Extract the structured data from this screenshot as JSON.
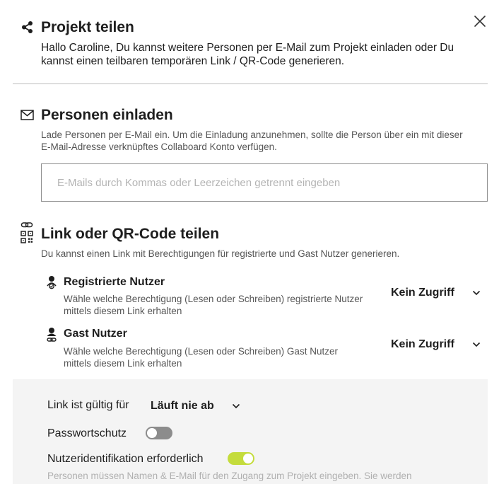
{
  "header": {
    "title": "Projekt teilen",
    "description": "Hallo Caroline, Du kannst weitere Personen per E-Mail zum Projekt einladen oder Du kannst einen teilbaren temporären Link / QR-Code generieren."
  },
  "invite": {
    "title": "Personen einladen",
    "description": "Lade Personen per E-Mail ein. Um die Einladung anzunehmen, sollte die Person über ein mit dieser E-Mail-Adresse verknüpftes Collaboard Konto verfügen.",
    "email_value": "",
    "email_placeholder": "E-Mails durch Kommas oder Leerzeichen getrennt eingeben"
  },
  "link_share": {
    "title": "Link oder QR-Code teilen",
    "description": "Du kannst einen Link mit Berechtigungen für registrierte und Gast Nutzer generieren.",
    "permissions": [
      {
        "title": "Registrierte Nutzer",
        "description": "Wähle welche Berechtigung (Lesen oder Schreiben) registrierte Nutzer mittels diesem Link erhalten",
        "selected": "Kein Zugriff",
        "icon": "registered-user-icon"
      },
      {
        "title": "Gast Nutzer",
        "description": "Wähle welche Berechtigung (Lesen oder Schreiben) Gast Nutzer mittels diesem Link erhalten",
        "selected": "Kein Zugriff",
        "icon": "guest-user-icon"
      }
    ]
  },
  "settings": {
    "validity_label": "Link ist gültig für",
    "validity_value": "Läuft nie ab",
    "password_label": "Passwortschutz",
    "password_enabled": false,
    "identification_label": "Nutzeridentifikation erforderlich",
    "identification_enabled": true,
    "identification_note": "Personen müssen Namen & E-Mail für den Zugang zum Projekt eingeben. Sie werden"
  },
  "colors": {
    "toggle_on": "#c4dc3c",
    "toggle_off": "#8c8c8c",
    "panel_background": "#f4f4f4"
  }
}
